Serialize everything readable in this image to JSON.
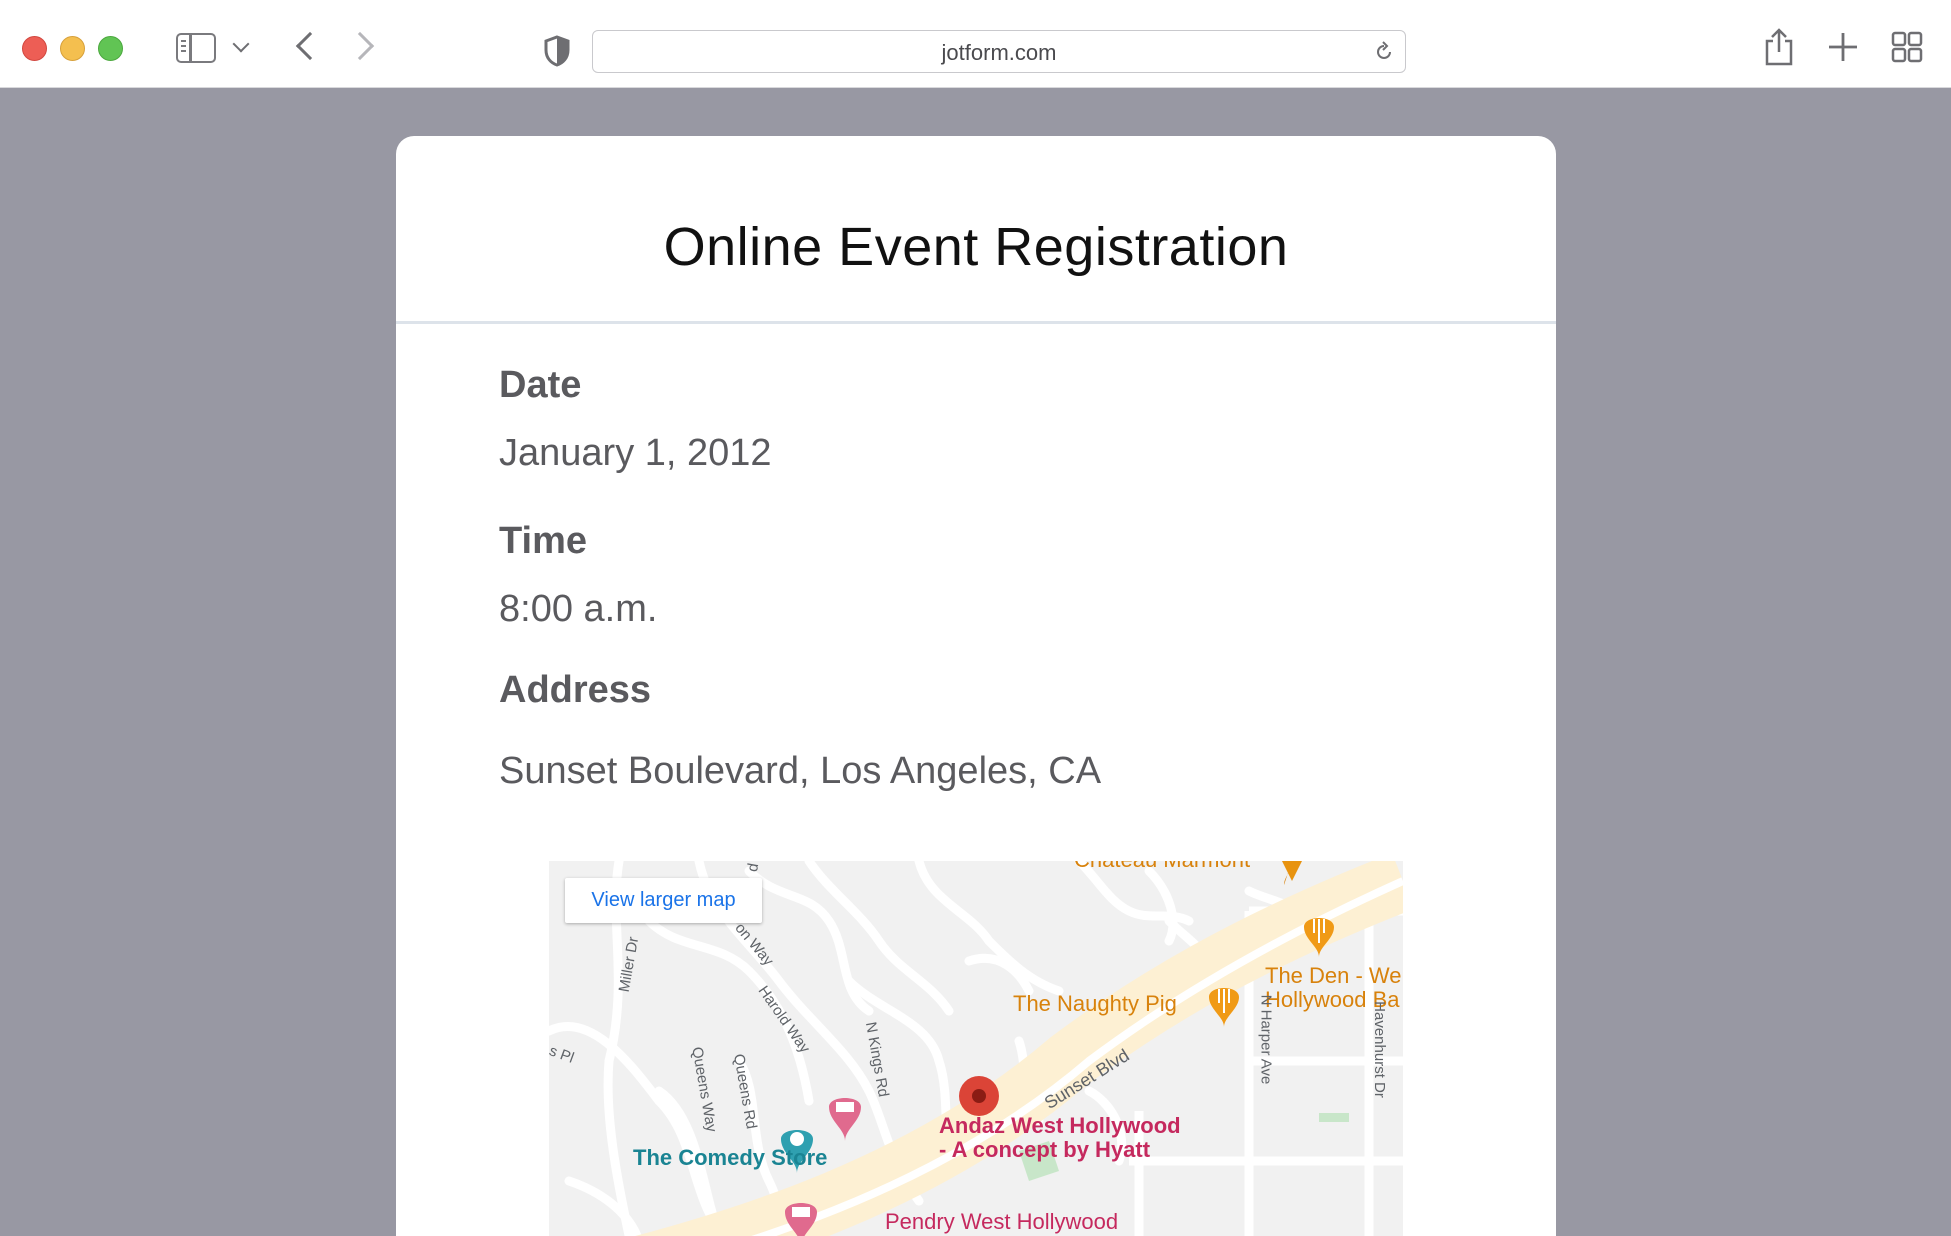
{
  "browser": {
    "url": "jotform.com"
  },
  "form": {
    "title": "Online Event Registration",
    "date_label": "Date",
    "date_value": "January 1, 2012",
    "time_label": "Time",
    "time_value": "8:00 a.m.",
    "address_label": "Address",
    "address_value": "Sunset Boulevard, Los Angeles, CA"
  },
  "map": {
    "link_label": "View larger map",
    "places": {
      "chateau": "Chateau Marmont",
      "the_den_1": "The Den - We",
      "the_den_2": "Hollywood Ba",
      "naughty_pig": "The Naughty Pig",
      "andaz_1": "Andaz West Hollywood",
      "andaz_2": "- A concept by Hyatt",
      "comedy_store": "The Comedy Store",
      "pendry": "Pendry West Hollywood"
    },
    "roads": {
      "miller": "Miller Dr",
      "on_way": "on Way",
      "harold": "Harold Way",
      "queens_pl": "s Pl",
      "queens_way": "Queens Way",
      "queens_rd": "Queens Rd",
      "kings": "N Kings Rd",
      "sunset": "Sunset Blvd",
      "harper": "N Harper Ave",
      "havenhurst": "Havenhurst Dr",
      "d": "d"
    }
  },
  "colors": {
    "backdrop": "#9898a3",
    "accent_link": "#1a73e8",
    "poi_orange": "#d8820c",
    "poi_pink": "#c5295e",
    "poi_teal": "#1a8493"
  }
}
